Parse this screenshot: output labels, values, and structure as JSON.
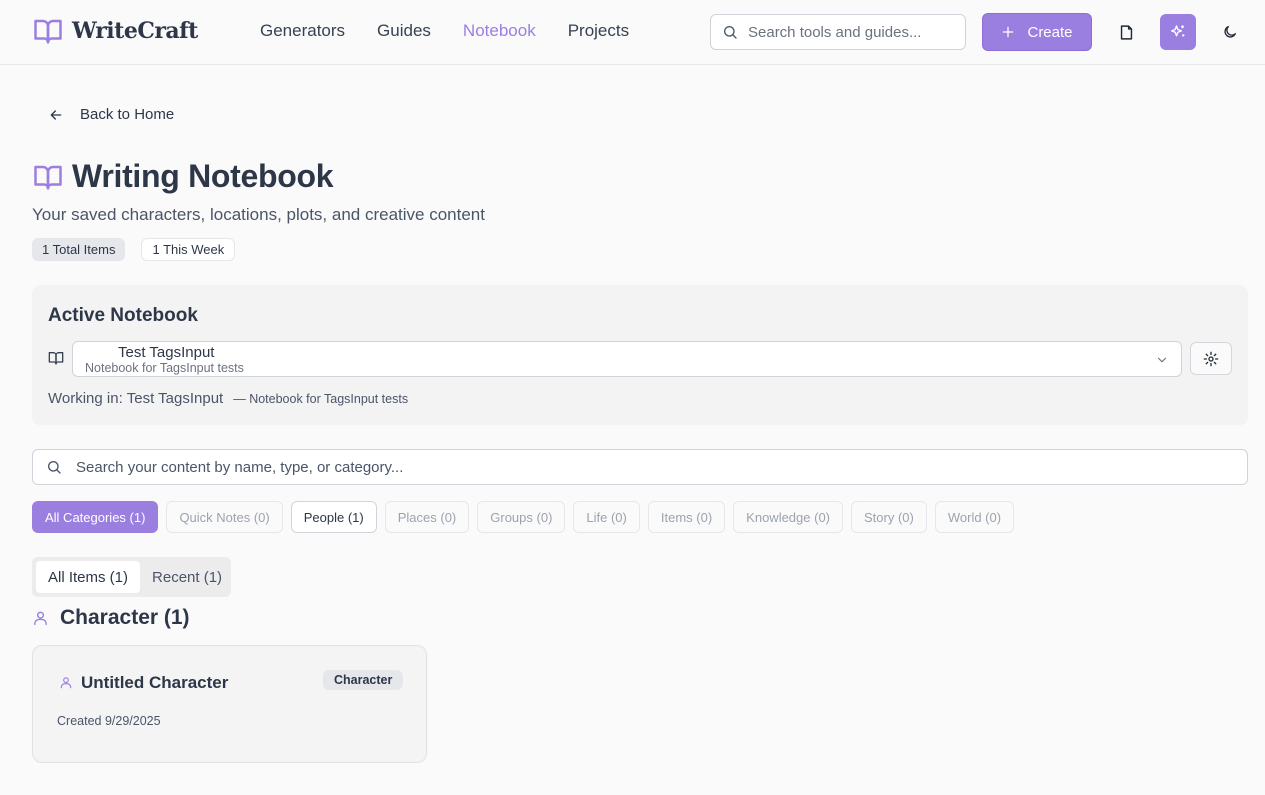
{
  "app": {
    "logo_text": "WriteCraft",
    "accent_color": "#9b7fe0"
  },
  "nav": {
    "items": [
      {
        "label": "Generators",
        "active": false
      },
      {
        "label": "Guides",
        "active": false
      },
      {
        "label": "Notebook",
        "active": true
      },
      {
        "label": "Projects",
        "active": false
      }
    ]
  },
  "header": {
    "search_placeholder": "Search tools and guides...",
    "create_label": "Create",
    "icons": [
      "search-icon",
      "plus-icon",
      "document-icon",
      "sparkles-icon",
      "moon-icon"
    ]
  },
  "back": {
    "label": "Back to Home"
  },
  "page": {
    "title": "Writing Notebook",
    "subtitle": "Your saved characters, locations, plots, and creative content",
    "stats": {
      "total": "1 Total Items",
      "week": "1 This Week"
    }
  },
  "notebook": {
    "heading": "Active Notebook",
    "selected_name": "Test TagsInput",
    "selected_description": "Notebook for TagsInput tests",
    "working_label": "Working in:",
    "working_name": "Test TagsInput",
    "working_description": "— Notebook for TagsInput tests"
  },
  "content_search": {
    "placeholder": "Search your content by name, type, or category..."
  },
  "categories": [
    {
      "label": "All Categories (1)",
      "state": "active"
    },
    {
      "label": "Quick Notes (0)",
      "state": "empty"
    },
    {
      "label": "People (1)",
      "state": "has"
    },
    {
      "label": "Places (0)",
      "state": "empty"
    },
    {
      "label": "Groups (0)",
      "state": "empty"
    },
    {
      "label": "Life (0)",
      "state": "empty"
    },
    {
      "label": "Items (0)",
      "state": "empty"
    },
    {
      "label": "Knowledge (0)",
      "state": "empty"
    },
    {
      "label": "Story (0)",
      "state": "empty"
    },
    {
      "label": "World (0)",
      "state": "empty"
    }
  ],
  "view_tabs": [
    {
      "label": "All Items (1)",
      "active": true
    },
    {
      "label": "Recent (1)",
      "active": false
    }
  ],
  "section": {
    "heading": "Character (1)"
  },
  "card": {
    "title": "Untitled Character",
    "badge": "Character",
    "created": "Created 9/29/2025"
  }
}
